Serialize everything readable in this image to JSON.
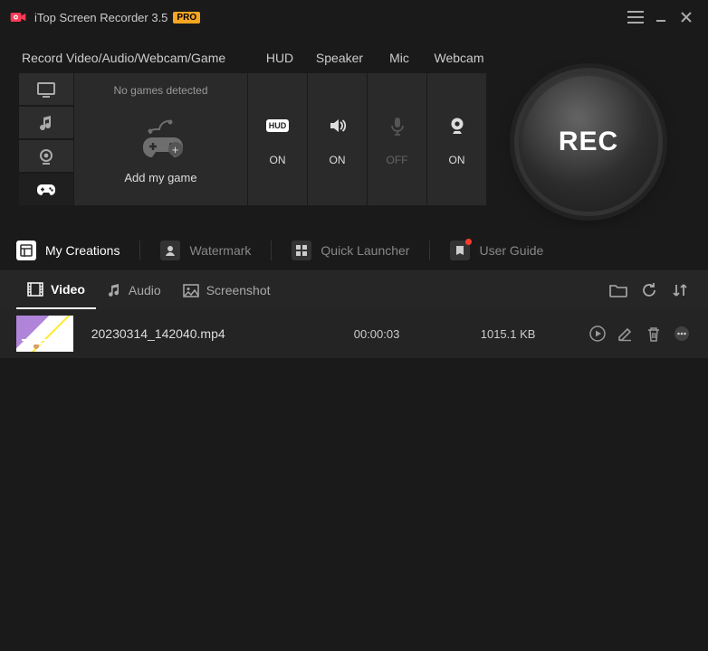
{
  "title": "iTop Screen Recorder 3.5",
  "pro_badge": "PRO",
  "labels": {
    "main": "Record Video/Audio/Webcam/Game",
    "hud": "HUD",
    "speaker": "Speaker",
    "mic": "Mic",
    "webcam": "Webcam"
  },
  "game_panel": {
    "msg": "No games detected",
    "add": "Add my game"
  },
  "toggles": {
    "hud": {
      "state": "ON",
      "on": true
    },
    "speaker": {
      "state": "ON",
      "on": true
    },
    "mic": {
      "state": "OFF",
      "on": false
    },
    "webcam": {
      "state": "ON",
      "on": true
    }
  },
  "rec_label": "REC",
  "nav": {
    "creations": "My Creations",
    "watermark": "Watermark",
    "launcher": "Quick Launcher",
    "guide": "User Guide"
  },
  "tabs": {
    "video": "Video",
    "audio": "Audio",
    "screenshot": "Screenshot"
  },
  "files": [
    {
      "name": "20230314_142040.mp4",
      "duration": "00:00:03",
      "size": "1015.1 KB"
    }
  ]
}
